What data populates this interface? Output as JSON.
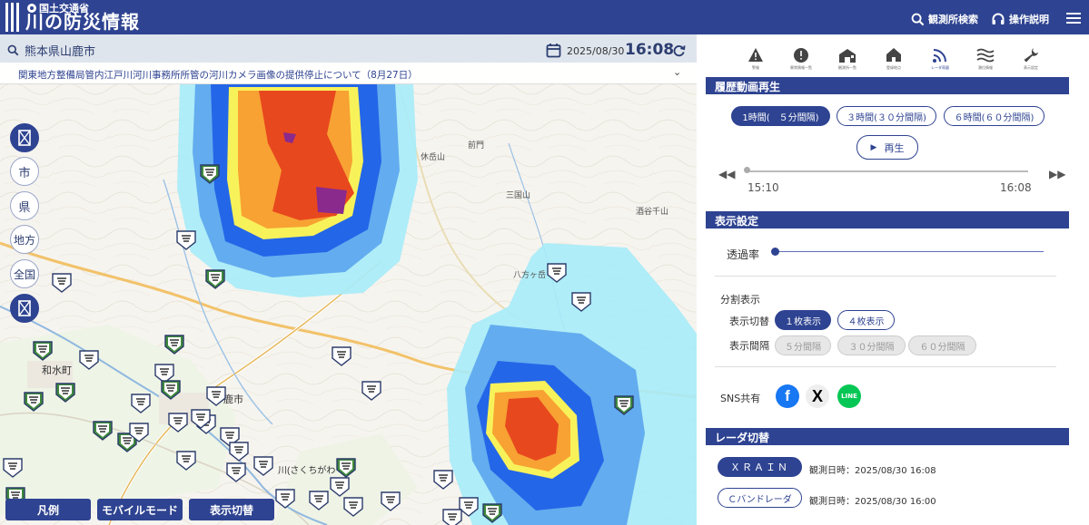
{
  "header": {
    "ministry": "国土交通省",
    "title": "川の防災情報",
    "search_label": "観測所検索",
    "help_label": "操作説明"
  },
  "location_bar": {
    "place": "熊本県山鹿市",
    "date": "2025/08/30",
    "time": "16:08"
  },
  "notice": {
    "text": "関東地方整備局管内江戸川河川事務所所管の河川カメラ画像の提供停止について（8月27日）"
  },
  "map": {
    "side_buttons": [
      "市",
      "県",
      "地方",
      "全国"
    ],
    "labels": [
      "和水町",
      "鹿市",
      "川(さくちがわ",
      "三国山",
      "八方ヶ岳",
      "酒谷千山",
      "休岳山",
      "前門"
    ],
    "bottom_buttons": {
      "legend": "凡例",
      "mobile": "モバイルモード",
      "toggle": "表示切替"
    }
  },
  "toolbar": {
    "items": [
      {
        "icon": "warning-icon",
        "label": "警報"
      },
      {
        "icon": "alert-circle-icon",
        "label": "異常情報一覧"
      },
      {
        "icon": "station-list-icon",
        "label": "観測所一覧"
      },
      {
        "icon": "home-icon",
        "label": "登録地点"
      },
      {
        "icon": "radar-icon",
        "label": "レーダ雨量"
      },
      {
        "icon": "waves-icon",
        "label": "潮位情報"
      },
      {
        "icon": "wrench-icon",
        "label": "表示設定"
      }
    ]
  },
  "history": {
    "heading": "履歴動画再生",
    "intervals": [
      "1時間(　５分間隔)",
      "３時間(３０分間隔)",
      "６時間(６０分間隔)"
    ],
    "selected_interval": 0,
    "play_label": "再生",
    "start_time": "15:10",
    "end_time": "16:08"
  },
  "display": {
    "heading": "表示設定",
    "opacity_label": "透過率",
    "split_label": "分割表示",
    "switch_label": "表示切替",
    "switch_options": [
      "１枚表示",
      "４枚表示"
    ],
    "interval_label": "表示間隔",
    "interval_options": [
      "５分間隔",
      "３０分間隔",
      "６０分間隔"
    ],
    "sns_label": "SNS共有"
  },
  "radar": {
    "heading": "レーダ切替",
    "sources": [
      {
        "name": "ＸＲＡＩＮ",
        "time": "観測日時：2025/08/30 16:08",
        "active": true
      },
      {
        "name": "Ｃバンドレーダ",
        "time": "観測日時：2025/08/30 16:00",
        "active": false
      }
    ]
  },
  "colors": {
    "brand": "#2e4391",
    "facebook": "#1877f2",
    "line": "#06c755"
  }
}
